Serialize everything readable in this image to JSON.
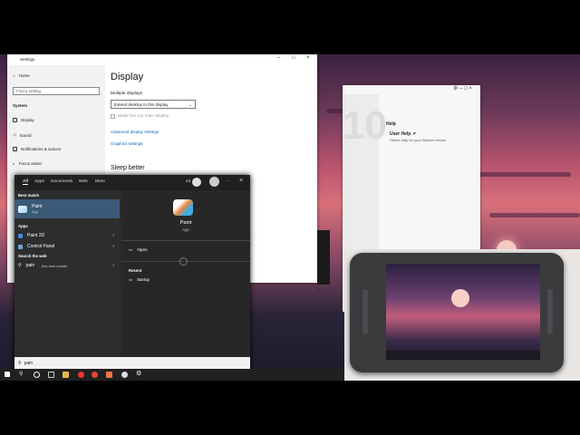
{
  "settings": {
    "title": "Settings",
    "home": "Home",
    "find_placeholder": "Find a setting",
    "section": "System",
    "nav": [
      "Display",
      "Sound",
      "Notifications & actions",
      "Focus assist"
    ],
    "page_title": "Display",
    "multiple_displays_label": "Multiple displays",
    "multiple_displays_value": "Extend desktop to this display",
    "make_main_display": "Make this my main display",
    "advanced_display_settings": "Advanced display settings",
    "graphics_settings": "Graphics settings",
    "sleep_better": "Sleep better"
  },
  "wacom": {
    "help_heading": "Help",
    "user_help_title": "User Help",
    "user_help_desc": "Online help for your Wacom device",
    "partial_text": "ings"
  },
  "start_menu": {
    "tabs": [
      "All",
      "Apps",
      "Documents",
      "Web",
      "More"
    ],
    "points": "24",
    "best_match_label": "Best match",
    "best_match_name": "Paint",
    "best_match_type": "App",
    "apps_label": "Apps",
    "apps": [
      "Paint 3D",
      "Control Panel"
    ],
    "search_web_label": "Search the web",
    "web_result": "pain",
    "web_result_suffix": "- See web results",
    "detail_name": "Paint",
    "detail_type": "App",
    "open_label": "Open",
    "recent_label": "Recent",
    "recent_items": [
      "Startup"
    ],
    "search_text": "pain"
  },
  "colors": {
    "accent": "#0067c0",
    "selection": "#3a5a78"
  },
  "icons": [
    "home-icon",
    "display-icon",
    "sound-icon",
    "notifications-icon",
    "focus-assist-icon",
    "paint-icon",
    "paint3d-icon",
    "control-panel-icon",
    "search-icon",
    "windows-start-icon"
  ]
}
